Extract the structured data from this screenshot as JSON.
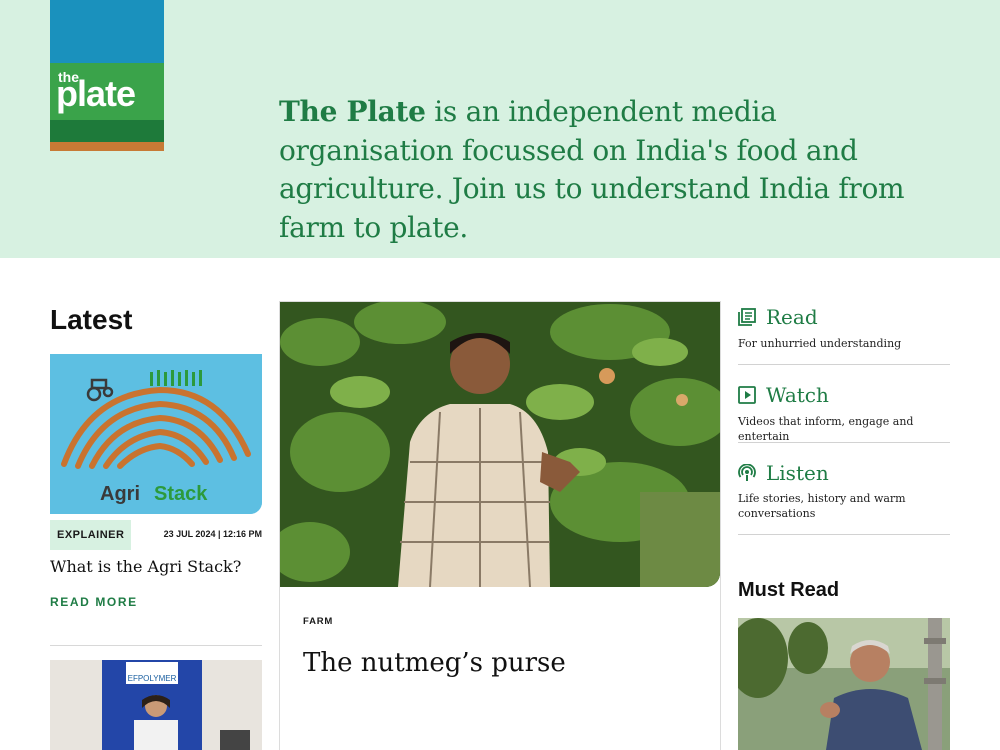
{
  "brand": {
    "logo_small": "the",
    "logo_main": "plate",
    "colors": {
      "accent_green": "#1f7c45",
      "hero_bg": "#d7f1e1",
      "logo_blue": "#1a91bd",
      "logo_orange": "#c77a35"
    }
  },
  "hero": {
    "tagline_bold": "The Plate",
    "tagline_rest": " is an independent media organisation focussed on India's food and agriculture. Join us to understand India from farm to plate."
  },
  "latest": {
    "heading": "Latest",
    "articles": [
      {
        "image_text_1": "Agri",
        "image_text_2": "Stack",
        "category": "EXPLAINER",
        "date": "23 JUL 2024 | 12:16 PM",
        "title": "What is the Agri Stack?",
        "cta": "READ MORE"
      },
      {
        "image_sign": "EFPOLYMER"
      }
    ]
  },
  "feature": {
    "category": "FARM",
    "title": "The nutmeg’s purse"
  },
  "menu": [
    {
      "icon": "newspaper-icon",
      "label": "Read",
      "description": "For unhurried understanding"
    },
    {
      "icon": "play-icon",
      "label": "Watch",
      "description": "Videos that inform, engage and entertain"
    },
    {
      "icon": "podcast-icon",
      "label": "Listen",
      "description": "Life stories, history and warm conversations"
    }
  ],
  "must_read": {
    "heading": "Must Read"
  }
}
